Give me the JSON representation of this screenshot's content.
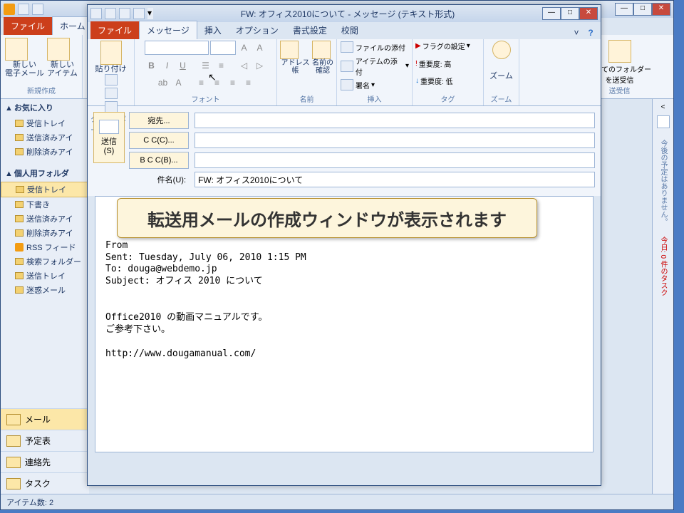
{
  "outlook": {
    "file_tab": "ファイル",
    "home_tab": "ホーム",
    "ribbon": {
      "new_email": "新しい\n電子メール",
      "new_items": "新しい\nアイテム",
      "group_new": "新規作成",
      "all_folders": "すべてのフォルダー\nを送受信",
      "group_sr": "送受信"
    },
    "nav": {
      "favorites": "お気に入り",
      "inbox": "受信トレイ",
      "sent": "送信済みアイ",
      "deleted": "削除済みアイ",
      "personal": "個人用フォルダ",
      "drafts": "下書き",
      "rss": "RSS フィード",
      "search": "検索フォルダー",
      "outbox": "送信トレイ",
      "junk": "迷惑メール",
      "mail": "メール",
      "calendar": "予定表",
      "contacts": "連絡先",
      "tasks": "タスク"
    },
    "right": {
      "text1": "今後の予定はありません。",
      "text2": "今日: 0 件のタスク"
    },
    "status": "アイテム数: 2"
  },
  "message": {
    "title": "FW: オフィス2010について - メッセージ (テキスト形式)",
    "tabs": {
      "file": "ファイル",
      "message": "メッセージ",
      "insert": "挿入",
      "options": "オプション",
      "format": "書式設定",
      "review": "校閲"
    },
    "ribbon": {
      "paste": "貼り付け",
      "group_clip": "クリップボード",
      "group_font": "フォント",
      "addressbook": "アドレス帳",
      "checkname": "名前の\n確認",
      "group_name": "名前",
      "attachfile": "ファイルの添付",
      "attachitem": "アイテムの添付",
      "signature": "署名",
      "group_insert": "挿入",
      "flag": "フラグの設定",
      "imp_high": "重要度: 高",
      "imp_low": "重要度: 低",
      "group_tag": "タグ",
      "zoom": "ズーム",
      "group_zoom": "ズーム"
    },
    "send": "送信\n(S)",
    "to_btn": "宛先...",
    "cc_btn": "C C(C)...",
    "bcc_btn": "B C C(B)...",
    "subject_lbl": "件名(U):",
    "subject_val": "FW: オフィス2010について",
    "body": "\n\n\nFrom\nSent: Tuesday, July 06, 2010 1:15 PM\nTo: douga@webdemo.jp\nSubject: オフィス 2010 について\n\n\nOffice2010 の動画マニュアルです。\nご参考下さい。\n\nhttp://www.dougamanual.com/"
  },
  "callout": "転送用メールの作成ウィンドウが表示されます"
}
